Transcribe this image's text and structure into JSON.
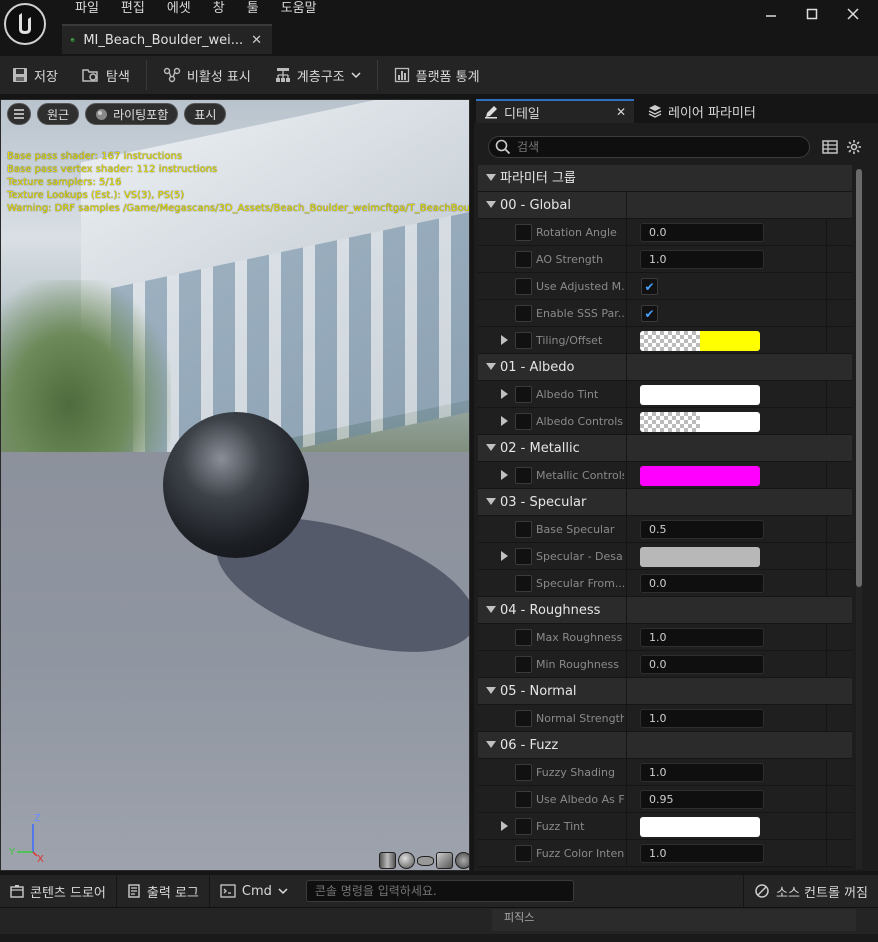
{
  "menu": [
    "파일",
    "편집",
    "에셋",
    "창",
    "툴",
    "도움말"
  ],
  "window": {
    "minimize": "—",
    "maximize": "☐",
    "close": "✕"
  },
  "doc_tab": {
    "title": "MI_Beach_Boulder_wei...",
    "close": "✕"
  },
  "toolbar": {
    "save": "저장",
    "browse": "탐색",
    "inactive": "비활성 표시",
    "hierarchy": "계층구조",
    "platform_stats": "플랫폼 통계"
  },
  "viewport": {
    "btn_perspective": "원근",
    "btn_lit": "라이팅포함",
    "btn_show": "표시",
    "stats": [
      "Base pass shader: 167 instructions",
      "Base pass vertex shader: 112 instructions",
      "Texture samplers: 5/16",
      "Texture Lookups (Est.): VS(3), PS(5)",
      "Warning: DRF samples /Game/Megascans/3D_Assets/Beach_Boulder_weimcftga/T_BeachBou"
    ],
    "axis_z": "Z",
    "axis_y": "Y",
    "axis_x": "X"
  },
  "details": {
    "tab_details": "디테일",
    "tab_close": "✕",
    "tab_layers": "레이어 파라미터",
    "search_placeholder": "검색",
    "header": "파라미터 그룹"
  },
  "groups": [
    {
      "name": "00 - Global",
      "params": [
        {
          "label": "Rotation Angle",
          "type": "value",
          "value": "0.0"
        },
        {
          "label": "AO Strength",
          "type": "value",
          "value": "1.0"
        },
        {
          "label": "Use Adjusted M...",
          "type": "check",
          "value": "✔"
        },
        {
          "label": "Enable SSS Par...",
          "type": "check",
          "value": "✔"
        },
        {
          "label": "Tiling/Offset",
          "type": "swatch",
          "expand": true,
          "swatch": "checker-yellow",
          "color": "#ffff00"
        }
      ]
    },
    {
      "name": "01 - Albedo",
      "params": [
        {
          "label": "Albedo Tint",
          "type": "swatch",
          "expand": true,
          "swatch": "solid",
          "color": "#ffffff"
        },
        {
          "label": "Albedo Controls",
          "type": "swatch",
          "expand": true,
          "swatch": "checker-white",
          "color": "#ffffff"
        }
      ]
    },
    {
      "name": "02 - Metallic",
      "params": [
        {
          "label": "Metallic Controls",
          "type": "swatch",
          "expand": true,
          "swatch": "solid",
          "color": "#ff00ff"
        }
      ]
    },
    {
      "name": "03 - Specular",
      "params": [
        {
          "label": "Base Specular",
          "type": "value",
          "value": "0.5"
        },
        {
          "label": "Specular - Desa...",
          "type": "swatch",
          "expand": true,
          "swatch": "solid",
          "color": "#b8b8b8"
        },
        {
          "label": "Specular From...",
          "type": "value",
          "value": "0.0"
        }
      ]
    },
    {
      "name": "04 - Roughness",
      "params": [
        {
          "label": "Max Roughness",
          "type": "value",
          "value": "1.0"
        },
        {
          "label": "Min Roughness",
          "type": "value",
          "value": "0.0"
        }
      ]
    },
    {
      "name": "05 - Normal",
      "params": [
        {
          "label": "Normal Strength",
          "type": "value",
          "value": "1.0"
        }
      ]
    },
    {
      "name": "06 - Fuzz",
      "params": [
        {
          "label": "Fuzzy Shading",
          "type": "value",
          "value": "1.0"
        },
        {
          "label": "Use Albedo As F...",
          "type": "value",
          "value": "0.95"
        },
        {
          "label": "Fuzz Tint",
          "type": "swatch",
          "expand": true,
          "swatch": "solid",
          "color": "#ffffff"
        },
        {
          "label": "Fuzz Color Inten...",
          "type": "value",
          "value": "1.0"
        }
      ]
    }
  ],
  "bottom": {
    "content_drawer": "콘텐츠 드로어",
    "output_log": "출력 로그",
    "cmd": "Cmd",
    "cmd_placeholder": "콘솔 명령을 입력하세요.",
    "source_control": "소스 컨트롤 꺼짐"
  },
  "footer": {
    "panel_label": "피직스"
  },
  "colors": {
    "accent": "#2f6fbf",
    "check": "#4a9eff",
    "stats_text": "#e8e000"
  }
}
